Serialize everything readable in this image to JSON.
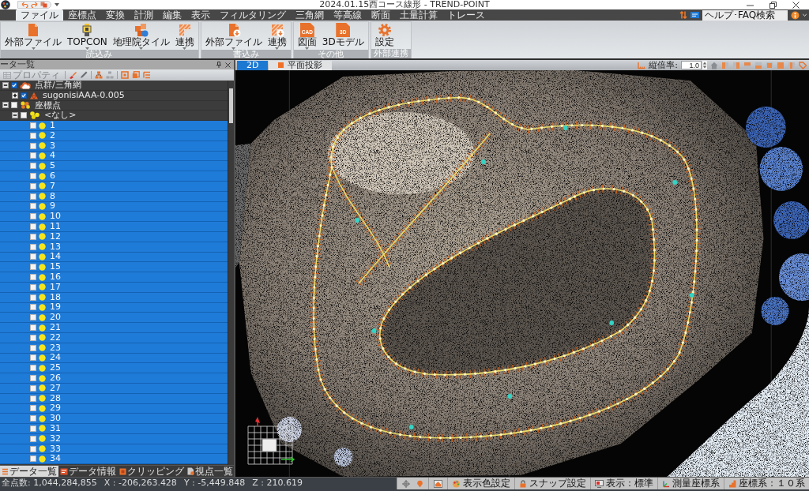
{
  "window": {
    "title": "2024.01.15西コース線形 - TREND-POINT"
  },
  "menu_tabs": [
    {
      "label": "ファイル",
      "selected": true
    },
    {
      "label": "座標点",
      "selected": false
    },
    {
      "label": "変換",
      "selected": false
    },
    {
      "label": "計測",
      "selected": false
    },
    {
      "label": "編集",
      "selected": false
    },
    {
      "label": "表示",
      "selected": false
    },
    {
      "label": "フィルタリング",
      "selected": false
    },
    {
      "label": "三角網",
      "selected": false
    },
    {
      "label": "等高線",
      "selected": false
    },
    {
      "label": "断面",
      "selected": false
    },
    {
      "label": "土量計算",
      "selected": false
    },
    {
      "label": "トレース",
      "selected": false
    }
  ],
  "help_search": {
    "placeholder": "ヘルプ･FAQ検索"
  },
  "ribbon_groups": [
    {
      "label": "読込み",
      "buttons": [
        {
          "label": "外部ファイル",
          "kind": "file",
          "dropdown": true
        },
        {
          "label": "TOPCON",
          "kind": "instrument",
          "dropdown": true
        },
        {
          "label": "地理院タイル",
          "kind": "tiles",
          "dropdown": true
        },
        {
          "label": "連携",
          "kind": "link",
          "dropdown": true
        }
      ]
    },
    {
      "label": "書込み",
      "buttons": [
        {
          "label": "外部ファイル",
          "kind": "file-export",
          "dropdown": true
        },
        {
          "label": "連携",
          "kind": "link-export",
          "dropdown": true
        }
      ]
    },
    {
      "label": "その他",
      "buttons": [
        {
          "label": "図面",
          "kind": "cad",
          "badge": "CAD",
          "dropdown": true
        },
        {
          "label": "3Dモデル",
          "kind": "model",
          "badge": "3D",
          "dropdown": false
        }
      ]
    },
    {
      "label": "外部連携",
      "buttons": [
        {
          "label": "設定",
          "kind": "gear",
          "dropdown": false
        }
      ]
    }
  ],
  "data_panel": {
    "title": "ータ一覧",
    "properties_button": {
      "label": "プロパティ",
      "disabled": true
    },
    "tree": [
      {
        "label": "点群/三角網",
        "kind": "pointcloud",
        "expanded": true,
        "checked": true,
        "selected": false,
        "children": [
          {
            "label": "sugonisiAAA-0.005",
            "kind": "mesh",
            "expanded": false,
            "checked": true,
            "selected": false
          }
        ]
      },
      {
        "label": "座標点",
        "kind": "points-group",
        "expanded": true,
        "checked": false,
        "selected": false,
        "children": [
          {
            "label": "<なし>",
            "kind": "point-set",
            "expanded": true,
            "checked": false,
            "selected": false,
            "children": [
              {
                "label": "1",
                "kind": "point",
                "checked": false,
                "selected": true
              },
              {
                "label": "2",
                "kind": "point",
                "checked": false,
                "selected": true
              },
              {
                "label": "3",
                "kind": "point",
                "checked": false,
                "selected": true
              },
              {
                "label": "4",
                "kind": "point",
                "checked": false,
                "selected": true
              },
              {
                "label": "5",
                "kind": "point",
                "checked": false,
                "selected": true
              },
              {
                "label": "6",
                "kind": "point",
                "checked": false,
                "selected": true
              },
              {
                "label": "7",
                "kind": "point",
                "checked": false,
                "selected": true
              },
              {
                "label": "8",
                "kind": "point",
                "checked": false,
                "selected": true
              },
              {
                "label": "9",
                "kind": "point",
                "checked": false,
                "selected": true
              },
              {
                "label": "10",
                "kind": "point",
                "checked": false,
                "selected": true
              },
              {
                "label": "11",
                "kind": "point",
                "checked": false,
                "selected": true
              },
              {
                "label": "12",
                "kind": "point",
                "checked": false,
                "selected": true
              },
              {
                "label": "13",
                "kind": "point",
                "checked": false,
                "selected": true
              },
              {
                "label": "14",
                "kind": "point",
                "checked": false,
                "selected": true
              },
              {
                "label": "15",
                "kind": "point",
                "checked": false,
                "selected": true
              },
              {
                "label": "16",
                "kind": "point",
                "checked": false,
                "selected": true
              },
              {
                "label": "17",
                "kind": "point",
                "checked": false,
                "selected": true
              },
              {
                "label": "18",
                "kind": "point",
                "checked": false,
                "selected": true
              },
              {
                "label": "19",
                "kind": "point",
                "checked": false,
                "selected": true
              },
              {
                "label": "20",
                "kind": "point",
                "checked": false,
                "selected": true
              },
              {
                "label": "21",
                "kind": "point",
                "checked": false,
                "selected": true
              },
              {
                "label": "22",
                "kind": "point",
                "checked": false,
                "selected": true
              },
              {
                "label": "23",
                "kind": "point",
                "checked": false,
                "selected": true
              },
              {
                "label": "24",
                "kind": "point",
                "checked": false,
                "selected": true
              },
              {
                "label": "25",
                "kind": "point",
                "checked": false,
                "selected": true
              },
              {
                "label": "26",
                "kind": "point",
                "checked": false,
                "selected": true
              },
              {
                "label": "27",
                "kind": "point",
                "checked": false,
                "selected": true
              },
              {
                "label": "28",
                "kind": "point",
                "checked": false,
                "selected": true
              },
              {
                "label": "29",
                "kind": "point",
                "checked": false,
                "selected": true
              },
              {
                "label": "30",
                "kind": "point",
                "checked": false,
                "selected": true
              },
              {
                "label": "31",
                "kind": "point",
                "checked": false,
                "selected": true
              },
              {
                "label": "32",
                "kind": "point",
                "checked": false,
                "selected": true
              },
              {
                "label": "33",
                "kind": "point",
                "checked": false,
                "selected": true
              },
              {
                "label": "34",
                "kind": "point",
                "checked": false,
                "selected": true
              }
            ]
          }
        ]
      }
    ],
    "tabs": [
      {
        "label": "データ一覧",
        "kind": "list",
        "selected": true
      },
      {
        "label": "データ情報",
        "kind": "info",
        "selected": false
      },
      {
        "label": "クリッピング",
        "kind": "clip",
        "selected": false
      },
      {
        "label": "視点一覧",
        "kind": "viewpoint",
        "selected": false
      }
    ]
  },
  "viewport": {
    "tabs": [
      {
        "label": "2D",
        "kind": "plain",
        "selected": true
      },
      {
        "label": "平面投影",
        "kind": "projection",
        "selected": false
      }
    ],
    "vertical_scale": {
      "label": "縦倍率:",
      "value": "1.0"
    }
  },
  "status_bar": {
    "readouts": [
      "全点数: 1,044,284,855",
      "X : -206,263.428",
      "Y : -5,449.848",
      "Z : 210.619"
    ],
    "items": [
      {
        "label": "表示色設定",
        "kind": "color"
      },
      {
        "label": "スナップ設定",
        "kind": "snap"
      },
      {
        "label": "表示：標準",
        "kind": "display"
      },
      {
        "label": "測量座標系",
        "kind": "survey"
      },
      {
        "label": "座標系：１０系",
        "kind": "zone"
      }
    ]
  }
}
